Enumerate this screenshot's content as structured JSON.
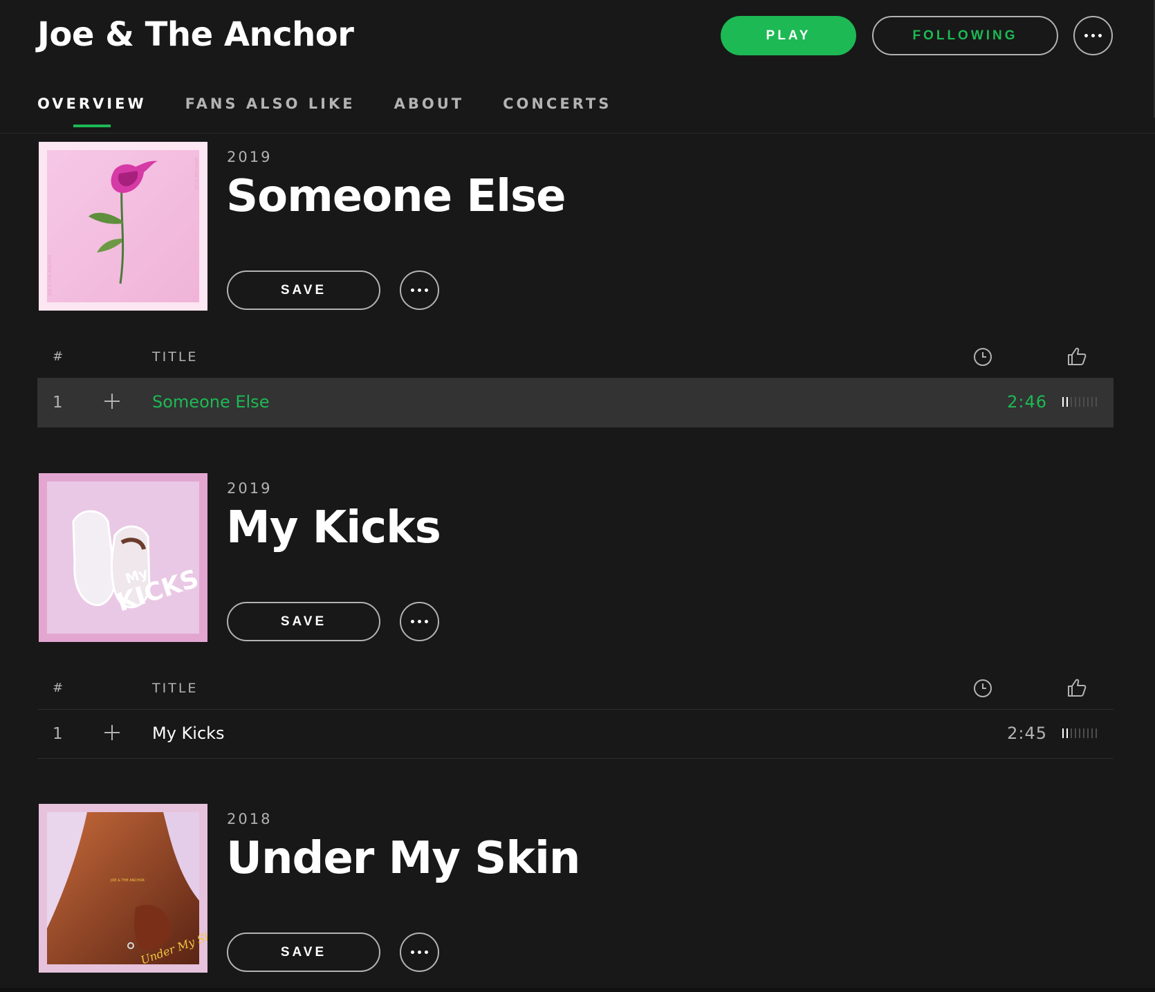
{
  "artist": {
    "name": "Joe & The Anchor",
    "play_label": "PLAY",
    "following_label": "FOLLOWING",
    "more_icon": "more-icon"
  },
  "tabs": [
    {
      "label": "OVERVIEW",
      "active": true
    },
    {
      "label": "FANS ALSO LIKE",
      "active": false
    },
    {
      "label": "ABOUT",
      "active": false
    },
    {
      "label": "CONCERTS",
      "active": false
    }
  ],
  "tracklist_header": {
    "number_label": "#",
    "title_label": "TITLE",
    "duration_icon": "clock-icon",
    "rating_icon": "thumbs-up-icon"
  },
  "albums": [
    {
      "year": "2019",
      "title": "Someone Else",
      "save_label": "SAVE",
      "tracks": [
        {
          "number": "1",
          "title": "Someone Else",
          "duration": "2:46",
          "selected": true,
          "popularity_bars": 2
        }
      ]
    },
    {
      "year": "2019",
      "title": "My Kicks",
      "save_label": "SAVE",
      "tracks": [
        {
          "number": "1",
          "title": "My Kicks",
          "duration": "2:45",
          "selected": false,
          "popularity_bars": 2
        }
      ]
    },
    {
      "year": "2018",
      "title": "Under My Skin",
      "save_label": "SAVE",
      "tracks": []
    }
  ],
  "colors": {
    "accent": "#1db954",
    "background": "#181818",
    "selected_row": "#333333",
    "muted_text": "#b3b3b3"
  }
}
